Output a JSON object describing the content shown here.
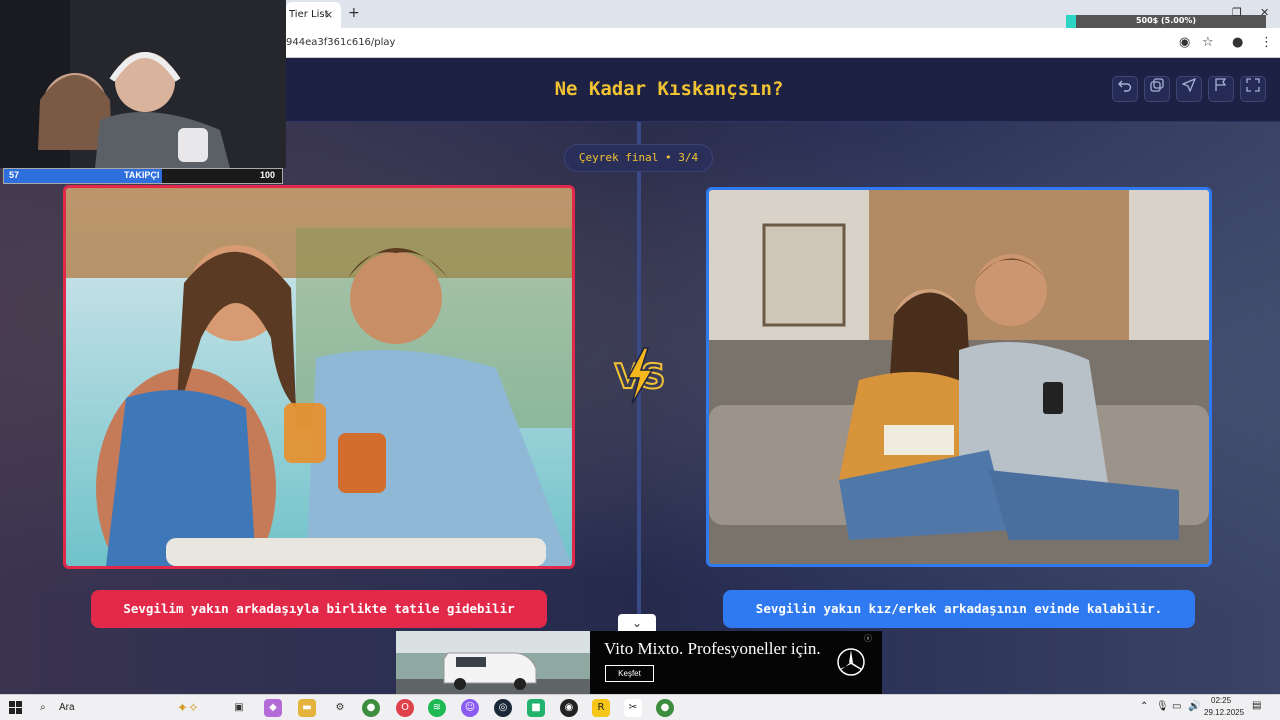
{
  "browser": {
    "tab_title": "Tier List",
    "tab_close": "×",
    "new_tab": "+",
    "url": "944ea3f361c616/play",
    "overlay_progress": {
      "text": "500$ (5.00%)",
      "fraction": 0.05
    }
  },
  "app": {
    "title": "Ne Kadar Kıskançsın?",
    "round": "Çeyrek final • 3/4",
    "header_buttons": [
      "undo-icon",
      "copy-icon",
      "send-icon",
      "flag-icon",
      "fullscreen-icon"
    ],
    "left_option": {
      "label": "Sevgilim yakın arkadaşıyla birlikte tatile gidebilir",
      "border_color": "#e3294a"
    },
    "right_option": {
      "label": "Sevgilin yakın kız/erkek arkadaşının evinde kalabilir.",
      "border_color": "#2f7af0"
    },
    "accent_color": "#f1c232"
  },
  "ad": {
    "headline": "Vito Mixto. Profesyoneller için.",
    "cta": "Keşfet",
    "expand_icon": "chevron-down-icon"
  },
  "stream": {
    "follower_goal": {
      "label": "TAKIPÇI",
      "current": "57",
      "target": "100",
      "fraction": 0.57
    }
  },
  "taskbar": {
    "search_placeholder": "Ara",
    "time": "02:25",
    "date": "29.12.2025"
  }
}
